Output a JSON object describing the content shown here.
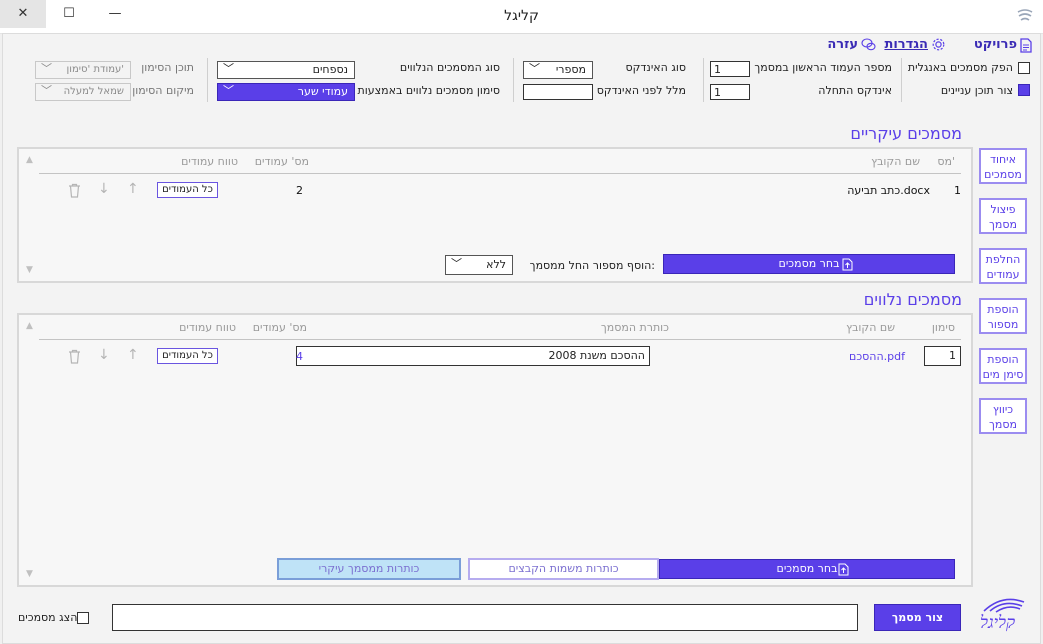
{
  "window": {
    "title": "קליגל",
    "close_glyph": "✕",
    "maximize_glyph": "☐",
    "minimize_glyph": "—"
  },
  "menu": {
    "project": "פרויקט",
    "settings": "הגדרות",
    "help": "עזרה"
  },
  "options": {
    "english_docs_label": "הפק מסמכים באנגלית",
    "english_docs_checked": false,
    "toc_label": "צור תוכן עניינים",
    "toc_checked": true,
    "first_page_label": "מספר העמוד הראשון במסמך",
    "first_page_value": "1",
    "index_start_label": "אינדקס התחלה",
    "index_start_value": "1",
    "index_type_label": "סוג האינדקס",
    "index_type_value": "מספרי",
    "before_index_label": "מלל לפני האינדקס",
    "before_index_value": "",
    "attached_type_label": "סוג המסמכים הנלווים",
    "attached_type_value": "נספחים",
    "mark_attached_label": "סימון מסמכים נלווים באמצעות",
    "mark_attached_value": "עמודי שער",
    "mark_content_label": "תוכן הסימון",
    "mark_content_value": "עמודת 'סימון'",
    "mark_position_label": "מיקום הסימון",
    "mark_position_value": "שמאל למעלה"
  },
  "side_buttons": [
    {
      "line1": "איחוד",
      "line2": "מסמכים"
    },
    {
      "line1": "פיצול",
      "line2": "מסמך"
    },
    {
      "line1": "החלפת",
      "line2": "עמודים"
    },
    {
      "line1": "הוספת",
      "line2": "מספור"
    },
    {
      "line1": "הוספת",
      "line2": "סימן מים"
    },
    {
      "line1": "כיווץ",
      "line2": "מסמך"
    }
  ],
  "main_docs": {
    "title": "מסמכים עיקריים",
    "headers": {
      "num": "מס'",
      "filename": "שם הקובץ",
      "pages": "מס' עמודים",
      "range": "טווח עמודים"
    },
    "rows": [
      {
        "num": "1",
        "filename": "כתב תביעה.docx",
        "pages": "2",
        "range": "כל העמודים"
      }
    ],
    "add_number_label": "הוסף מספור החל ממסמך:",
    "add_number_value": "ללא",
    "choose_button": "בחר מסמכים"
  },
  "attached_docs": {
    "title": "מסמכים נלווים",
    "headers": {
      "mark": "סימון",
      "filename": "שם הקובץ",
      "doc_title": "כותרת המסמך",
      "pages": "מס' עמודים",
      "range": "טווח עמודים"
    },
    "rows": [
      {
        "mark": "1",
        "filename": "ההסכם.pdf",
        "doc_title": "ההסכם משנת 2008",
        "pages": "4",
        "range": "כל העמודים"
      }
    ],
    "choose_button": "בחר מסמכים",
    "titles_from_files_button": "כותרות משמות הקבצים",
    "titles_from_main_button": "כותרות ממסמך עיקרי"
  },
  "footer": {
    "create_button": "צור מסמך",
    "path_value": "",
    "show_docs_label": "הצג מסמכים",
    "show_docs_checked": false,
    "logo_text": "קליגל"
  },
  "colors": {
    "accent": "#5a3fe8",
    "accent_dark": "#3a26b8",
    "side_border": "#9b8cf0"
  }
}
